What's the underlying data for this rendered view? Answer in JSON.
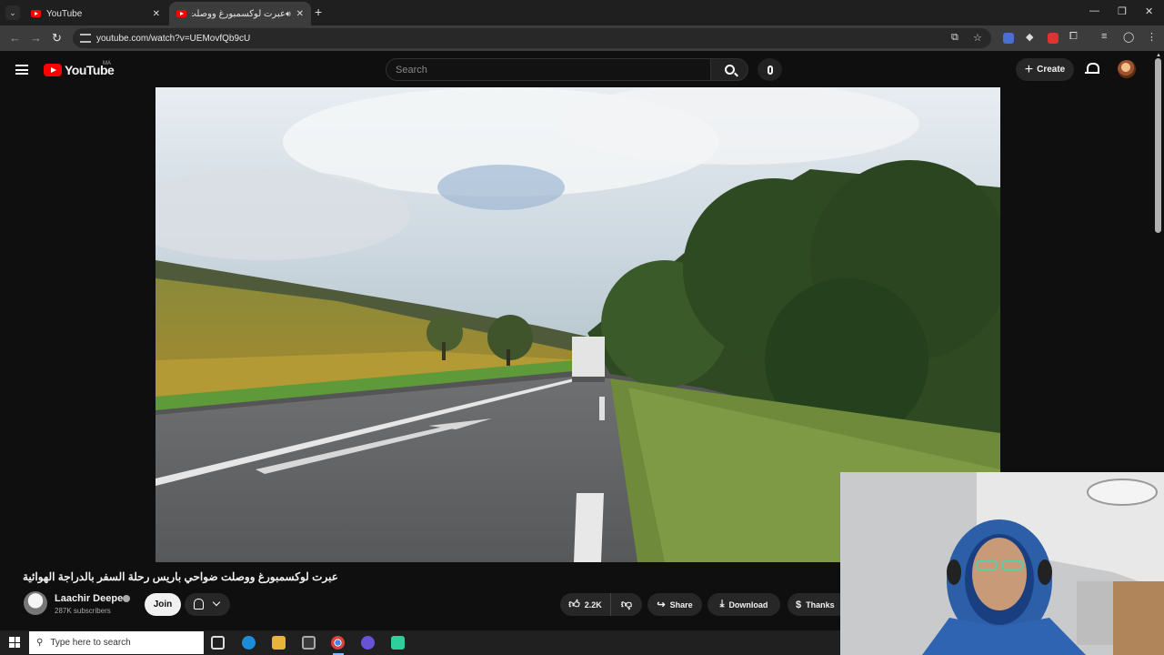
{
  "browser": {
    "tabs": [
      {
        "title": "YouTube",
        "active": false
      },
      {
        "title": "عبرت لوكسمبورغ ووصلت ض",
        "active": true
      }
    ],
    "url": "youtube.com/watch?v=UEMovfQb9cU"
  },
  "youtube": {
    "logo_text": "YouTube",
    "region": "MA",
    "search_placeholder": "Search",
    "create_label": "Create"
  },
  "video": {
    "title": "عبرت لوكسمبورغ ووصلت ضواحي باريس رحلة السفر بالدراجة الهوائية",
    "channel": "Laachir Deeper",
    "subscribers": "287K subscribers",
    "join_label": "Join",
    "likes": "2.2K",
    "share_label": "Share",
    "download_label": "Download",
    "thanks_label": "Thanks"
  },
  "taskbar": {
    "search_placeholder": "Type here to search"
  },
  "colors": {
    "background": "#0f0f0f",
    "accent_red": "#ff0000",
    "pill": "#272727"
  }
}
